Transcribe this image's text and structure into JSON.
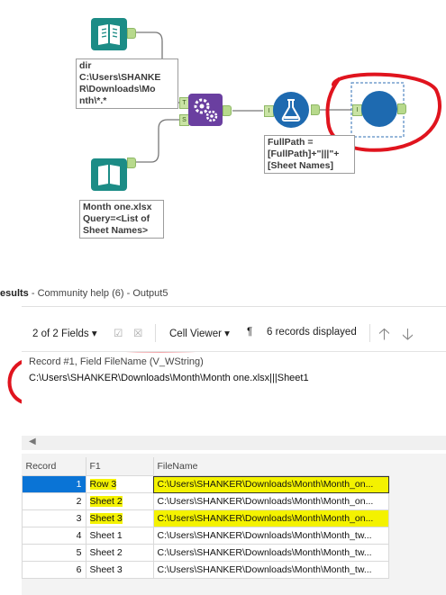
{
  "canvas": {
    "dir_annotation": "dir\nC:\\Users\\SHANKE\nR\\Downloads\\Mo\nnth\\*.*",
    "input_annotation": "Month one.xlsx\nQuery=<List of\nSheet Names>",
    "formula_annotation": "FullPath =\n[FullPath]+\"|||\"+\n[Sheet Names]",
    "dynamic_input_anchor_t": "T",
    "dynamic_input_anchor_s": "S",
    "formula_anchor": "I",
    "output_anchor": "I"
  },
  "results": {
    "title_prefix": "esults",
    "title_rest": " - Community help (6) - Output5",
    "fields_label": "2 of 2 Fields",
    "viewer_label": "Cell Viewer",
    "records_label": "6 records displayed",
    "detail_header": "Record #1, Field FileName (V_WString)",
    "detail_value": "C:\\Users\\SHANKER\\Downloads\\Month\\Month one.xlsx|||Sheet1",
    "columns": [
      "Record",
      "F1",
      "FileName"
    ],
    "rows": [
      {
        "record": "1",
        "f1": "Row 3",
        "filename": "C:\\Users\\SHANKER\\Downloads\\Month\\Month_on..."
      },
      {
        "record": "2",
        "f1": "Sheet 2",
        "filename": "C:\\Users\\SHANKER\\Downloads\\Month\\Month_on..."
      },
      {
        "record": "3",
        "f1": "Sheet 3",
        "filename": "C:\\Users\\SHANKER\\Downloads\\Month\\Month_on..."
      },
      {
        "record": "4",
        "f1": "Sheet 1",
        "filename": "C:\\Users\\SHANKER\\Downloads\\Month\\Month_tw..."
      },
      {
        "record": "5",
        "f1": "Sheet 2",
        "filename": "C:\\Users\\SHANKER\\Downloads\\Month\\Month_tw..."
      },
      {
        "record": "6",
        "f1": "Sheet 3",
        "filename": "C:\\Users\\SHANKER\\Downloads\\Month\\Month_tw..."
      }
    ]
  },
  "colors": {
    "accent": "#0a74d6",
    "highlight": "#f4f200",
    "annotation_red": "#e0141e",
    "tool_teal": "#1c8c86",
    "tool_purple": "#6a3fa0",
    "tool_blue": "#1e6ab0"
  }
}
